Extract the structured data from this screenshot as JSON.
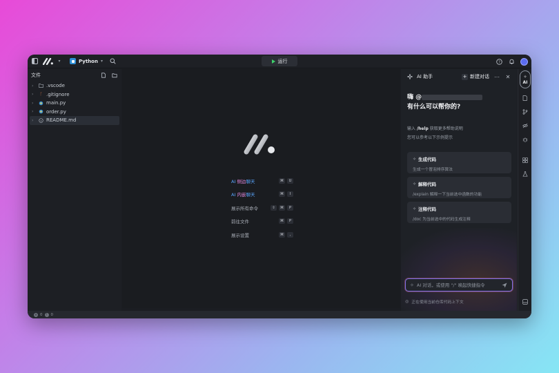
{
  "titlebar": {
    "language": "Python",
    "run_label": "运行"
  },
  "sidebar": {
    "title": "文件",
    "items": [
      {
        "label": ".vscode",
        "type": "folder"
      },
      {
        "label": ".gitignore",
        "type": "git"
      },
      {
        "label": "main.py",
        "type": "python"
      },
      {
        "label": "order.py",
        "type": "python"
      },
      {
        "label": "README.md",
        "type": "markdown",
        "active": true
      }
    ]
  },
  "editor": {
    "shortcuts": [
      {
        "prefix": "AI ",
        "highlight1": "侧边",
        "highlight2": "聊天",
        "keys": [
          "⌘",
          "U"
        ]
      },
      {
        "prefix": "AI ",
        "highlight1": "内嵌",
        "highlight2": "聊天",
        "keys": [
          "⌘",
          "I"
        ]
      },
      {
        "label": "展示所有命令",
        "keys": [
          "⇧",
          "⌘",
          "P"
        ]
      },
      {
        "label": "前往文件",
        "keys": [
          "⌘",
          "P"
        ]
      },
      {
        "label": "展示设置",
        "keys": [
          "⌘",
          ","
        ]
      }
    ]
  },
  "ai_panel": {
    "title": "AI 助手",
    "new_chat_label": "新建对话",
    "greeting_prefix": "嗨 @",
    "greeting_line2": "有什么可以帮你的?",
    "hint_prefix": "输入",
    "hint_cmd": "/help",
    "hint_suffix": "获取更多帮助说明",
    "hint_line2": "您可以参考以下示例提示",
    "cards": [
      {
        "title": "生成代码",
        "desc": "生成一个冒泡排序算法"
      },
      {
        "title": "解释代码",
        "desc": "/explain 解释一下当前选中函数的功能"
      },
      {
        "title": "注释代码",
        "desc": "/doc 为当前选中的代码生成注释"
      }
    ],
    "input_placeholder": "AI 对话，或使用 \"/\" 唤起快捷指令",
    "footer": "正在使用当前仓库代码上下文"
  },
  "rail": {
    "ai_label": "AI"
  },
  "statusbar": {
    "errors": "0",
    "warnings": "0"
  }
}
